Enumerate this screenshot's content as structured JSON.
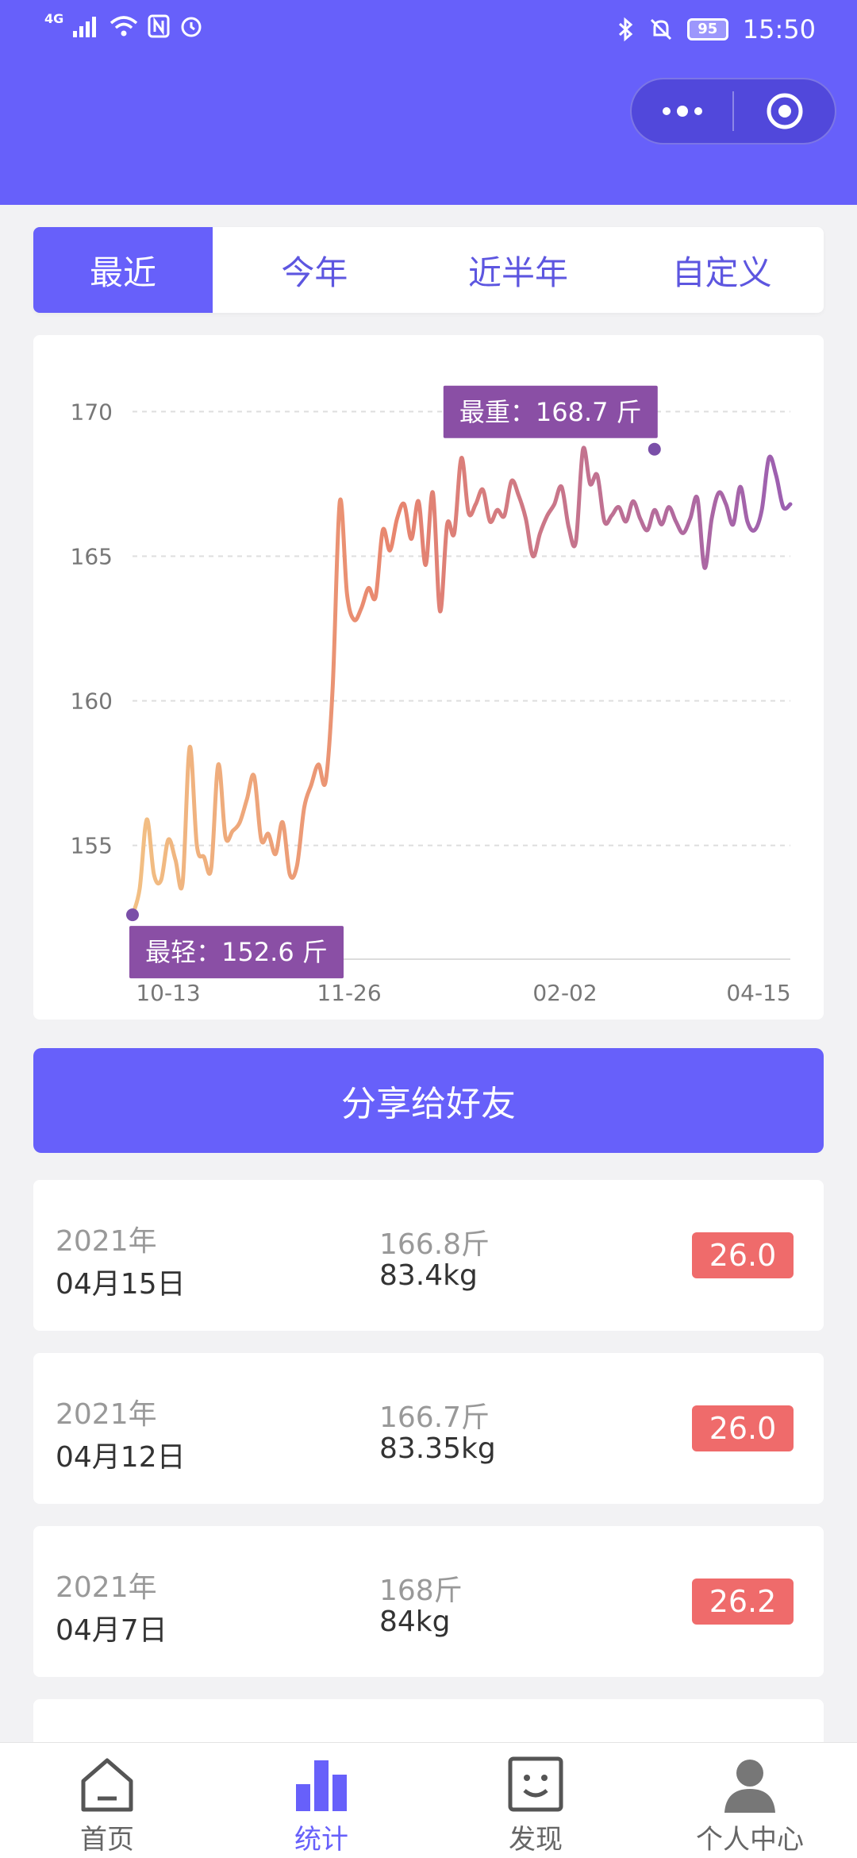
{
  "status": {
    "network": "4G",
    "battery": "95",
    "time": "15:50"
  },
  "tabs": [
    {
      "label": "最近",
      "active": true
    },
    {
      "label": "今年",
      "active": false
    },
    {
      "label": "近半年",
      "active": false
    },
    {
      "label": "自定义",
      "active": false
    }
  ],
  "chart_data": {
    "type": "line",
    "yticks": [
      155,
      160,
      165,
      170
    ],
    "ylim": [
      152,
      171
    ],
    "xticks": [
      "10-13",
      "11-26",
      "02-02",
      "04-15"
    ],
    "max_label": "最重：168.7 斤",
    "min_label": "最轻：152.6 斤",
    "max": {
      "index": 73,
      "value": 168.7
    },
    "min": {
      "index": 0,
      "value": 152.6
    },
    "values": [
      152.6,
      153.5,
      155.9,
      154.0,
      153.8,
      155.2,
      154.5,
      153.7,
      158.4,
      155.0,
      154.6,
      154.2,
      157.8,
      155.3,
      155.5,
      155.8,
      156.6,
      157.4,
      155.2,
      155.4,
      154.7,
      155.8,
      154.0,
      154.3,
      156.3,
      157.1,
      157.8,
      157.2,
      160.5,
      166.9,
      163.7,
      162.8,
      163.2,
      163.9,
      163.6,
      165.9,
      165.2,
      166.3,
      166.8,
      165.6,
      166.9,
      164.7,
      167.2,
      163.1,
      166.1,
      165.8,
      168.4,
      166.5,
      166.8,
      167.3,
      166.2,
      166.6,
      166.4,
      167.6,
      167.1,
      166.3,
      165.0,
      165.8,
      166.4,
      166.8,
      167.4,
      166.0,
      165.5,
      168.7,
      167.5,
      167.8,
      166.2,
      166.4,
      166.7,
      166.2,
      166.9,
      166.3,
      165.9,
      166.6,
      166.1,
      166.7,
      166.2,
      165.8,
      166.3,
      167.0,
      164.6,
      166.3,
      167.2,
      166.8,
      166.1,
      167.4,
      166.2,
      165.9,
      166.6,
      168.4,
      167.8,
      166.7,
      166.8
    ],
    "colors": {
      "start": "#f2c084",
      "mid": "#e8856e",
      "end": "#9b5fb2"
    }
  },
  "share_button": "分享给好友",
  "records": [
    {
      "year": "2021年",
      "date": "04月15日",
      "jin": "166.8斤",
      "kg": "83.4kg",
      "bmi": "26.0"
    },
    {
      "year": "2021年",
      "date": "04月12日",
      "jin": "166.7斤",
      "kg": "83.35kg",
      "bmi": "26.0"
    },
    {
      "year": "2021年",
      "date": "04月7日",
      "jin": "168斤",
      "kg": "84kg",
      "bmi": "26.2"
    }
  ],
  "nav": [
    {
      "label": "首页",
      "icon": "home-icon",
      "active": false
    },
    {
      "label": "统计",
      "icon": "bar-chart-icon",
      "active": true
    },
    {
      "label": "发现",
      "icon": "discover-icon",
      "active": false
    },
    {
      "label": "个人中心",
      "icon": "user-icon",
      "active": false
    }
  ],
  "colors": {
    "accent": "#6760fa",
    "badge": "#ef6b6b",
    "label_bg": "#8a4fa5"
  }
}
